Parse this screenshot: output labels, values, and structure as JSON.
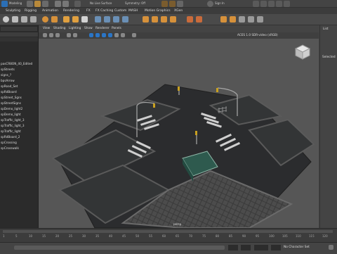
{
  "status_line": {
    "menu_set": "Modeling",
    "live_surface": "No Live Surface",
    "symmetry": "Symmetry: Off",
    "sign_in": "Sign In"
  },
  "shelf_tabs": [
    "Sculpting",
    "Rigging",
    "Animation",
    "Rendering",
    "FX",
    "FX Caching",
    "Custom",
    "MASH",
    "Motion Graphics",
    "XGen"
  ],
  "outliner": {
    "items": [
      "pasCR8ON_40_Edited",
      "spStreets",
      "signs_?",
      "bpsArrow",
      "spRoad_Set",
      "spRdBoard",
      "spStreet_Sgns",
      "spStreetSigns",
      "spDemo_light2",
      "spDemo_light",
      "spTraffic_light_3",
      "spTraffic_light_3",
      "spTraffic_light",
      "spRdBoard_2",
      "spCrossing",
      "spCrosswalk"
    ]
  },
  "viewport": {
    "menu": [
      "View",
      "Shading",
      "Lighting",
      "Show",
      "Renderer",
      "Panels"
    ],
    "color_space": "ACES 1.0 SDR-video (sRGB)",
    "camera_label": "persp"
  },
  "right_panel": {
    "tabs": [
      "List",
      "Selected"
    ]
  },
  "timeline": {
    "ticks": [
      "1",
      "5",
      "10",
      "15",
      "20",
      "25",
      "30",
      "35",
      "40",
      "45",
      "50",
      "55",
      "60",
      "65",
      "70",
      "75",
      "80",
      "85",
      "90",
      "95",
      "100",
      "105",
      "110",
      "115",
      "120"
    ],
    "character_set": "No Character Set"
  },
  "colors": {
    "accent": "#3b8fd8",
    "viewport_bg": "#565656",
    "road": "#2a2c2e",
    "paving": "#4a4a4a"
  }
}
